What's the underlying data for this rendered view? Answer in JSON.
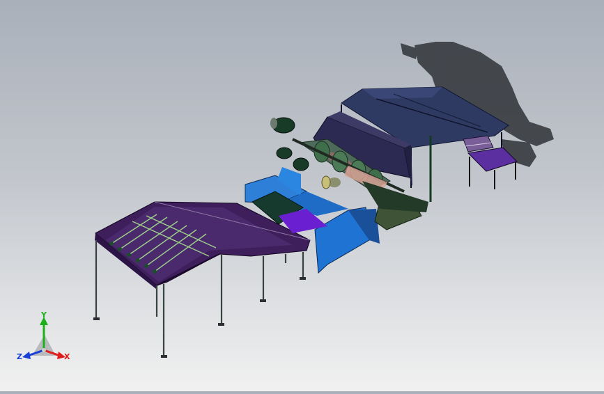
{
  "viewport": {
    "background_top": "#a9b0ba",
    "background_bottom": "#f1f1f1",
    "model_name": "",
    "components": [
      "shadow",
      "canopy",
      "side-table",
      "housing",
      "spindle-rollers",
      "drive-motors",
      "blue-frame",
      "green-bed",
      "purple-conveyor",
      "conveyor-rollers",
      "support-legs"
    ]
  },
  "triad": {
    "x_label": "X",
    "y_label": "Y",
    "z_label": "Z",
    "x_color": "#e01b1b",
    "y_color": "#1db01d",
    "z_color": "#1a3fd6"
  }
}
